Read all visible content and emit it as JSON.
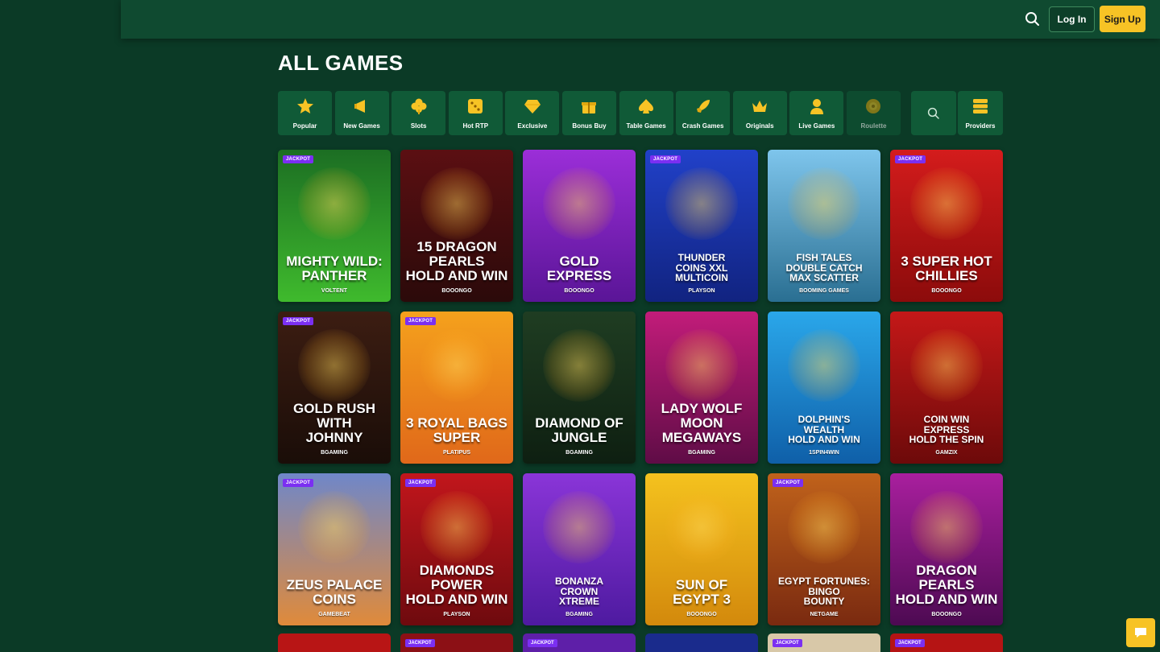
{
  "header": {
    "login_label": "Log In",
    "signup_label": "Sign Up",
    "search_icon": "search-icon",
    "colors": {
      "bar": "#0f4a30",
      "signup": "#f7c325"
    }
  },
  "page_title": "ALL GAMES",
  "categories": [
    {
      "label": "Popular",
      "icon": "star-icon"
    },
    {
      "label": "New Games",
      "icon": "new-megaphone-icon"
    },
    {
      "label": "Slots",
      "icon": "clover-icon"
    },
    {
      "label": "Hot RTP",
      "icon": "dice-icon"
    },
    {
      "label": "Exclusive",
      "icon": "diamond-icon"
    },
    {
      "label": "Bonus Buy",
      "icon": "gift-icon"
    },
    {
      "label": "Table Games",
      "icon": "spade-icon"
    },
    {
      "label": "Crash Games",
      "icon": "rocket-icon"
    },
    {
      "label": "Originals",
      "icon": "crown-icon"
    },
    {
      "label": "Live Games",
      "icon": "dealer-icon"
    },
    {
      "label": "Roulette",
      "icon": "roulette-icon"
    }
  ],
  "category_search_icon": "search-icon",
  "providers_label": "Providers",
  "badge_label": "JACKPOT",
  "games": [
    {
      "title": "MIGHTY WILD:\nPANTHER",
      "provider": "VOLTENT",
      "jackpot": true,
      "colors": [
        "#1c6e23",
        "#3fba2d"
      ]
    },
    {
      "title": "15 DRAGON PEARLS\nHOLD AND WIN",
      "provider": "BOOONGO",
      "jackpot": false,
      "colors": [
        "#5b0f12",
        "#2b0a0a"
      ]
    },
    {
      "title": "GOLD\nEXPRESS",
      "provider": "BOOONGO",
      "jackpot": false,
      "colors": [
        "#9b2ed8",
        "#5a1597"
      ]
    },
    {
      "title": "THUNDER\nCOINS XXL\nMULTICOIN",
      "provider": "PLAYSON",
      "jackpot": true,
      "colors": [
        "#2141c9",
        "#112380"
      ]
    },
    {
      "title": "FISH TALES\nDOUBLE CATCH\nMAX SCATTER",
      "provider": "BOOMING GAMES",
      "jackpot": false,
      "colors": [
        "#7ec5ec",
        "#2a6f92"
      ]
    },
    {
      "title": "3 SUPER HOT\nCHILLIES",
      "provider": "BOOONGO",
      "jackpot": true,
      "colors": [
        "#d41c1c",
        "#8c0b0b"
      ]
    },
    {
      "title": "GOLD RUSH WITH\nJOHNNY",
      "provider": "BGAMING",
      "jackpot": true,
      "colors": [
        "#3c1d12",
        "#1a0d08"
      ]
    },
    {
      "title": "3 ROYAL BAGS\nSUPER",
      "provider": "PLATIPUS",
      "jackpot": true,
      "colors": [
        "#f5a11c",
        "#e0681a"
      ]
    },
    {
      "title": "DIAMOND OF\nJUNGLE",
      "provider": "BGAMING",
      "jackpot": false,
      "colors": [
        "#1f3d22",
        "#0e1f11"
      ]
    },
    {
      "title": "LADY WOLF MOON\nMEGAWAYS",
      "provider": "BGAMING",
      "jackpot": false,
      "colors": [
        "#c21c7a",
        "#5f0c46"
      ]
    },
    {
      "title": "DOLPHIN'S\nWEALTH\nHOLD AND WIN",
      "provider": "1SPIN4WIN",
      "jackpot": false,
      "colors": [
        "#2aa7ea",
        "#0f5fa8"
      ]
    },
    {
      "title": "COIN WIN\nEXPRESS\nHOLD THE SPIN",
      "provider": "GAMZIX",
      "jackpot": false,
      "colors": [
        "#c41818",
        "#6d0a0a"
      ]
    },
    {
      "title": "ZEUS PALACE\nCOINS",
      "provider": "GAMEBEAT",
      "jackpot": true,
      "colors": [
        "#6f87c9",
        "#e08a3a"
      ]
    },
    {
      "title": "DIAMONDS POWER\nHOLD AND WIN",
      "provider": "PLAYSON",
      "jackpot": true,
      "colors": [
        "#c2161c",
        "#6e0a0e"
      ]
    },
    {
      "title": "BONANZA\nCROWN\nXTREME",
      "provider": "BGAMING",
      "jackpot": false,
      "colors": [
        "#8a35d8",
        "#4e1aa0"
      ]
    },
    {
      "title": "SUN OF\nEGYPT 3",
      "provider": "BOOONGO",
      "jackpot": false,
      "colors": [
        "#f4c21e",
        "#d3890c"
      ]
    },
    {
      "title": "EGYPT FORTUNES:\nBINGO\nBOUNTY",
      "provider": "NETGAME",
      "jackpot": true,
      "colors": [
        "#c0621b",
        "#7a2a10"
      ]
    },
    {
      "title": "DRAGON PEARLS\nHOLD AND WIN",
      "provider": "BOOONGO",
      "jackpot": false,
      "colors": [
        "#a91f9e",
        "#4d0a52"
      ]
    }
  ],
  "next_row": [
    {
      "jackpot": false,
      "color": "#b81515"
    },
    {
      "jackpot": true,
      "color": "#8c1015"
    },
    {
      "jackpot": true,
      "color": "#5e1fa8"
    },
    {
      "jackpot": false,
      "color": "#1a2b8c"
    },
    {
      "jackpot": true,
      "color": "#d8c8a8"
    },
    {
      "jackpot": true,
      "color": "#b51414"
    }
  ],
  "chat_icon": "chat-bubble-icon"
}
